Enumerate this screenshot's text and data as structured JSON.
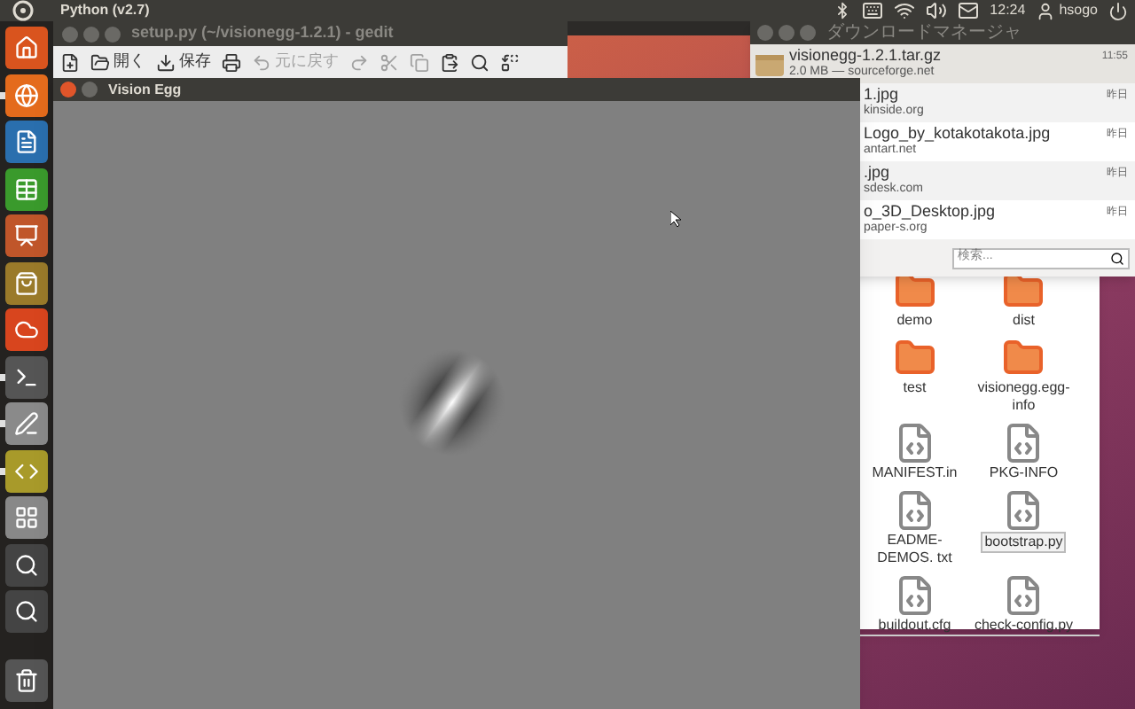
{
  "top_panel": {
    "app_title": "Python (v2.7)",
    "clock": "12:24",
    "user": "hsogo"
  },
  "launcher": [
    {
      "kind": "home",
      "running": false
    },
    {
      "kind": "browser",
      "running": true
    },
    {
      "kind": "document",
      "running": false
    },
    {
      "kind": "spreadsheet",
      "running": false
    },
    {
      "kind": "presentation",
      "running": false
    },
    {
      "kind": "software",
      "running": false
    },
    {
      "kind": "ubuntu-one",
      "running": false
    },
    {
      "kind": "terminal",
      "running": true
    },
    {
      "kind": "editor",
      "running": true
    },
    {
      "kind": "python",
      "running": true
    },
    {
      "kind": "workspaces",
      "running": false
    },
    {
      "kind": "lens",
      "running": false
    },
    {
      "kind": "lens",
      "running": false
    },
    {
      "kind": "trash",
      "running": false
    }
  ],
  "gedit": {
    "title": "setup.py (~/visionegg-1.2.1) - gedit",
    "toolbar": [
      {
        "kind": "new",
        "disabled": false
      },
      {
        "kind": "open",
        "label": "開く",
        "disabled": false
      },
      {
        "kind": "save",
        "label": "保存",
        "disabled": false
      },
      {
        "kind": "print",
        "disabled": false
      },
      {
        "kind": "undo",
        "label": "元に戻す",
        "disabled": true
      },
      {
        "kind": "redo",
        "disabled": true
      },
      {
        "kind": "cut",
        "disabled": true
      },
      {
        "kind": "copy",
        "disabled": true
      },
      {
        "kind": "paste",
        "disabled": false
      },
      {
        "kind": "find",
        "disabled": false
      },
      {
        "kind": "replace",
        "disabled": false
      }
    ]
  },
  "download_manager": {
    "title": "ダウンロードマネージャ",
    "downloads": [
      {
        "name": "visionegg-1.2.1.tar.gz",
        "detail": "2.0 MB — sourceforge.net",
        "time": "11:55",
        "selected": true
      },
      {
        "name": "1.jpg",
        "detail": "kinside.org",
        "time": "昨日",
        "selected": false
      },
      {
        "name": "Logo_by_kotakotakota.jpg",
        "detail": "antart.net",
        "time": "昨日",
        "selected": false
      },
      {
        "name": ".jpg",
        "detail": "sdesk.com",
        "time": "昨日",
        "selected": false
      },
      {
        "name": "o_3D_Desktop.jpg",
        "detail": "paper-s.org",
        "time": "昨日",
        "selected": false
      }
    ],
    "search": {
      "placeholder": "検索..."
    }
  },
  "file_manager": {
    "items": [
      {
        "name": "demo",
        "kind": "folder",
        "selected": false
      },
      {
        "name": "dist",
        "kind": "folder",
        "selected": false
      },
      {
        "name": "test",
        "kind": "folder",
        "selected": false
      },
      {
        "name": "visionegg.egg-info",
        "kind": "folder",
        "selected": false
      },
      {
        "name": "MANIFEST.in",
        "kind": "file",
        "selected": false
      },
      {
        "name": "PKG-INFO",
        "kind": "file",
        "selected": false
      },
      {
        "name": "EADME-DEMOS. txt",
        "kind": "file",
        "selected": false
      },
      {
        "name": "bootstrap.py",
        "kind": "file",
        "selected": true
      },
      {
        "name": "buildout.cfg",
        "kind": "file",
        "selected": false
      },
      {
        "name": "check-config.py",
        "kind": "file",
        "selected": false
      }
    ]
  },
  "vision_egg": {
    "title": "Vision Egg"
  }
}
